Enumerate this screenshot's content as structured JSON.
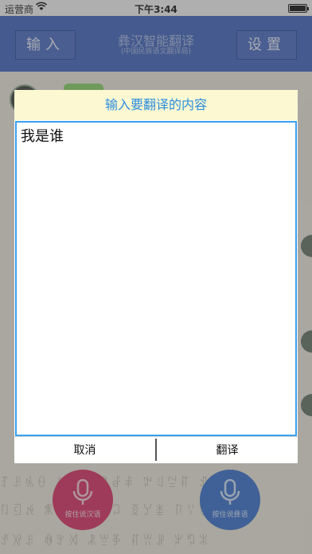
{
  "status_bar": {
    "carrier": "运营商",
    "time": "下午3:44"
  },
  "nav": {
    "left_button": "输入",
    "right_button": "设置",
    "title": "彝汉智能翻译",
    "subtitle": "(中国民族语文翻译局)"
  },
  "background": {
    "mic_left_label": "按住说汉语",
    "mic_right_label": "按住说彝语"
  },
  "dialog": {
    "title": "输入要翻译的内容",
    "text_value": "我是谁",
    "cancel_label": "取消",
    "translate_label": "翻译"
  },
  "colors": {
    "nav_blue": "#3359b8",
    "dialog_header_bg": "#fbf8d2",
    "dialog_header_text": "#2d8ddc",
    "text_border": "#3aa0f0",
    "mic_red": "#d6225a",
    "mic_blue": "#2a66c8"
  }
}
